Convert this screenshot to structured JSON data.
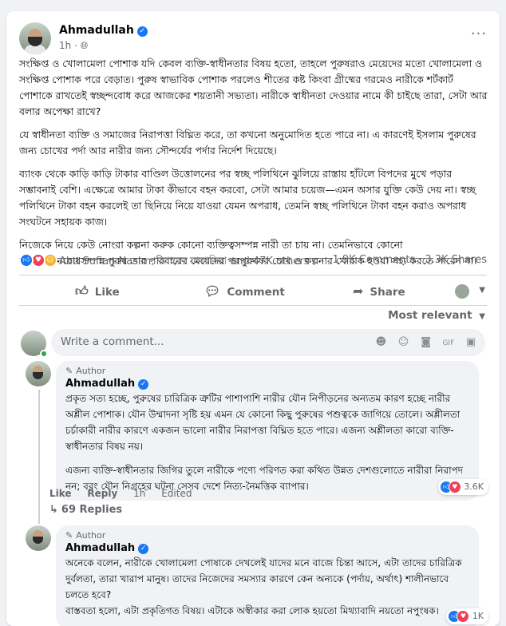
{
  "post": {
    "author": "Ahmadullah",
    "time": "1h",
    "privacy_icon": "globe-icon",
    "paragraphs": [
      "সংক্ষিপ্ত ও খোলামেলা পোশাক যদি কেবল ব্যক্তি-স্বাধীনতার বিষয় হতো, তাহলে পুরুষরাও মেয়েদের মতো খোলামেলা ও সংক্ষিপ্ত পোশাক পরে বেড়াত। পুরুষ স্বাভাবিক পোশাক পরলেও শীতের কষ্ট কিংবা গ্রীষ্মের গরমেও নারীকে শর্টকার্ট পোশাকে রাখতেই স্বচ্ছন্দবোধ করে আজকের শয়তানী সভ্যতা। নারীকে স্বাধীনতা দেওয়ার নামে কী চাইছে তারা, সেটা আর বলার অপেক্ষা রাখে?",
      "যে স্বাধীনতা ব্যক্তি ও সমাজের নিরাপত্তা বিঘ্নিত করে, তা কখনো অনুমোদিত হতে পারে না। এ কারণেই ইসলাম পুরুষের জন্য চোখের পর্দা আর নারীর জন্য সৌন্দর্যের পর্দার নির্দেশ দিয়েছে।",
      "ব্যাংক থেকে কাড়ি কাড়ি টাকার বাণ্ডিল উত্তোলনের পর স্বচ্ছ পলিথিনে  ঝুলিয়ে রাস্তায় হাঁটলে বিপদের মুখে পড়ার সম্ভাবনাই বেশি। এক্ষেত্রে আমার টাকা কীভাবে বহন করবো, সেটা আমার চয়েজ—এমন অসার যুক্তি কেউ দেয় না। স্বচ্ছ পলিথিনে টাকা বহন করলেই তা ছিনিয়ে নিয়ে যাওয়া যেমন অপরাধ, তেমনি স্বচ্ছ পলিথিনে টাকা বহন করাও অপরাধ সংঘটনে সহায়ক কাজ।",
      "নিজেকে নিয়ে কেউ নোংরা কল্পনা করুক কোনো ব্যক্তিত্বসম্পন্ন নারী তা চায় না। তেমনিভাবে কোনো আত্মসম্মানবোধসম্পন্ন পুরুষ তার পরিবারের মেয়েদের পরপুরুষের চোখ ও কল্পনার খোরাক হওয়া সহ্য করতে পারেন না।"
    ],
    "reactors_text": "Abu Sufian Nasim, আহমদ যাকারিয়া and 47K others",
    "comments_count": "1.9K Comments",
    "shares_count": "3.3K Shares"
  },
  "actions": {
    "like": "Like",
    "comment": "Comment",
    "share": "Share"
  },
  "sort_label": "Most relevant",
  "composer": {
    "placeholder": "Write a comment..."
  },
  "comments": [
    {
      "badge": "Author",
      "name": "Ahmadullah",
      "paragraphs": [
        "প্রকৃত সত্য হচ্ছে, পুরুষের চারিত্রিক ত্রুটির পাশাপাশি নারীর যৌন নিপীড়নের অন্যতম কারণ হচ্ছে নারীর অশ্লীল পোশাক। যৌন উম্মাদনা সৃষ্টি হয় এমন যে কোনো কিছু পুরুষের পশুত্বকে জাগিয়ে তোলে। অশ্লীলতা চর্চাকারী নারীর কারণে একজন ভালো নারীর নিরাপত্তা বিঘ্নিত হতে পারে। এজন্য অশ্লীলতা কারো ব্যক্তি-স্বাধীনতার বিষয় নয়।",
        "এজন্য ব্যক্তি-স্বাধীনতার জিগির তুলে নারীকে পণ্যে পরিণত করা কথিত উন্নত দেশগুলোতে নারীরা নিরাপদ নন; বরং যৌন নিগ্রহের ঘটনা সেসব দেশে নিত্য-নৈমত্তিক ব্যাপার।"
      ],
      "like": "Like",
      "reply": "Reply",
      "time": "1h",
      "edited": "Edited",
      "reactions": "3.6K",
      "replies": "69 Replies"
    },
    {
      "badge": "Author",
      "name": "Ahmadullah",
      "paragraphs": [
        "অনেকে বলেন, নারীকে খোলামেলা পোষাকে দেখলেই যাদের মনে বাজে চিন্তা আসে, এটা তাদের চারিত্রিক দুর্বলতা, তারা খারাপ মানুষ। তাদের নিজেদের সমস্যার কারণে কেন অন্যকে (পর্দায়, অর্থাৎ) শালীনভাবে চলতে হবে?",
        "বাস্তবতা হলো, এটা প্রকৃতিগত বিষয়। এটাকে অস্বীকার করা লোক হয়তো মিথ্যাবাদি নয়তো নপুংষক।"
      ],
      "reactions": "1K"
    }
  ],
  "colors": {
    "accent": "#1877f2",
    "like_blue": "#1877f2",
    "love_red": "#f33e58",
    "care_yellow": "#f7b125"
  }
}
